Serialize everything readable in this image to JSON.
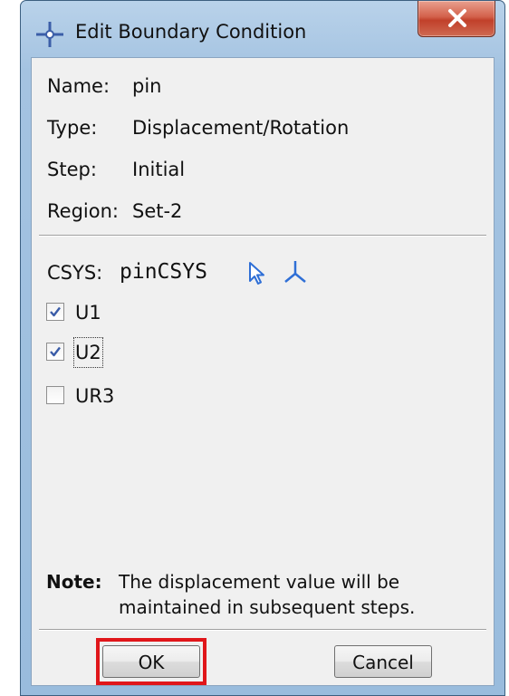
{
  "window": {
    "title": "Edit Boundary Condition",
    "accent_color": "#e0161a"
  },
  "info": {
    "name_label": "Name:",
    "name_value": "pin",
    "type_label": "Type:",
    "type_value": "Displacement/Rotation",
    "step_label": "Step:",
    "step_value": "Initial",
    "region_label": "Region:",
    "region_value": "Set-2"
  },
  "csys": {
    "label": "CSYS:",
    "value": "pinCSYS",
    "select_icon": "arrow-cursor-icon",
    "create_icon": "triad-icon"
  },
  "checkboxes": [
    {
      "label": "U1",
      "checked": true
    },
    {
      "label": "U2",
      "checked": true
    },
    {
      "label": "UR3",
      "checked": false
    }
  ],
  "note": {
    "label": "Note:",
    "text": "The displacement value will be maintained in subsequent steps."
  },
  "buttons": {
    "ok": "OK",
    "cancel": "Cancel"
  }
}
